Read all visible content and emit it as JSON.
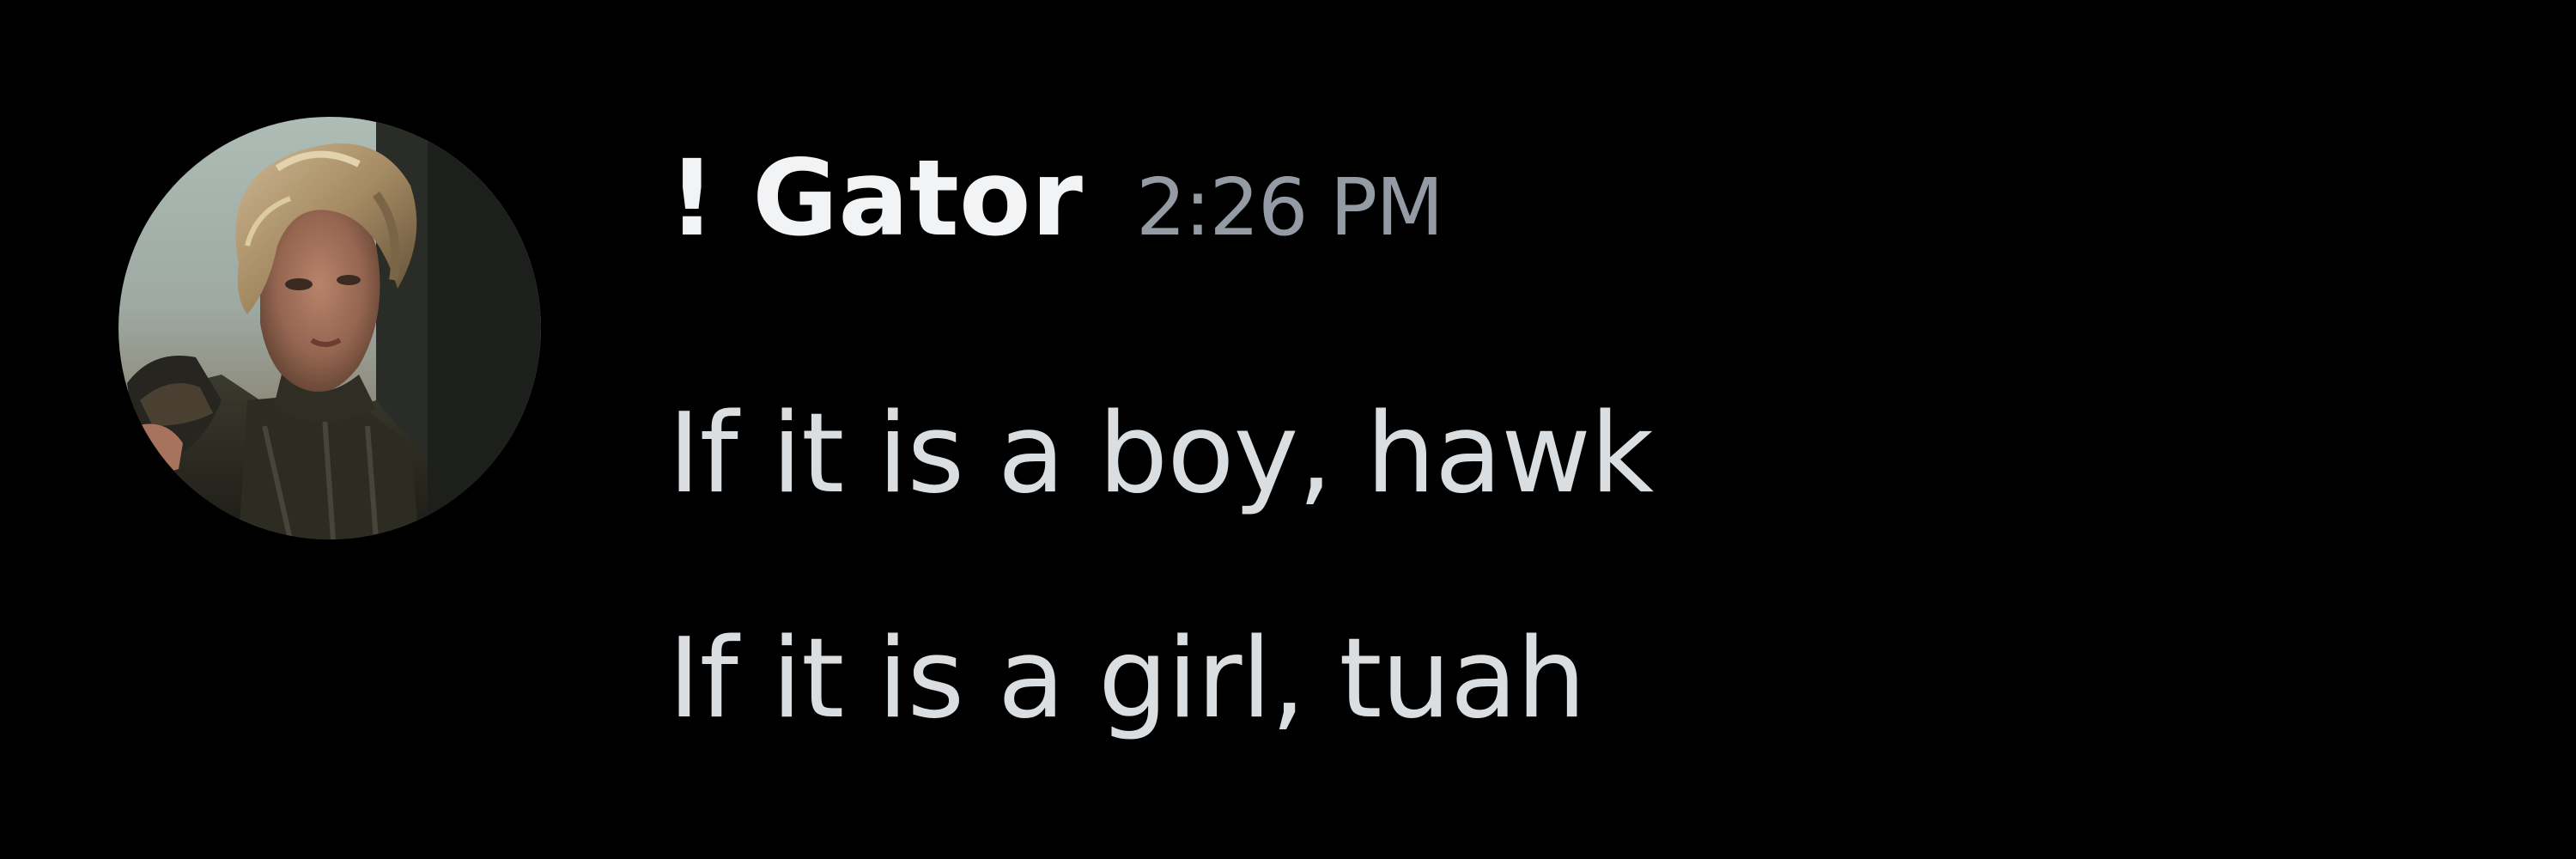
{
  "message": {
    "username": "! Gator",
    "timestamp": "2:26 PM",
    "lines": [
      "If it is a boy, hawk",
      "If it is a girl, tuah"
    ]
  },
  "colors": {
    "background": "#000000",
    "username": "#f2f3f5",
    "timestamp": "#949ba4",
    "text": "#dbdee1"
  },
  "avatar": {
    "icon": "user-avatar-photo"
  }
}
